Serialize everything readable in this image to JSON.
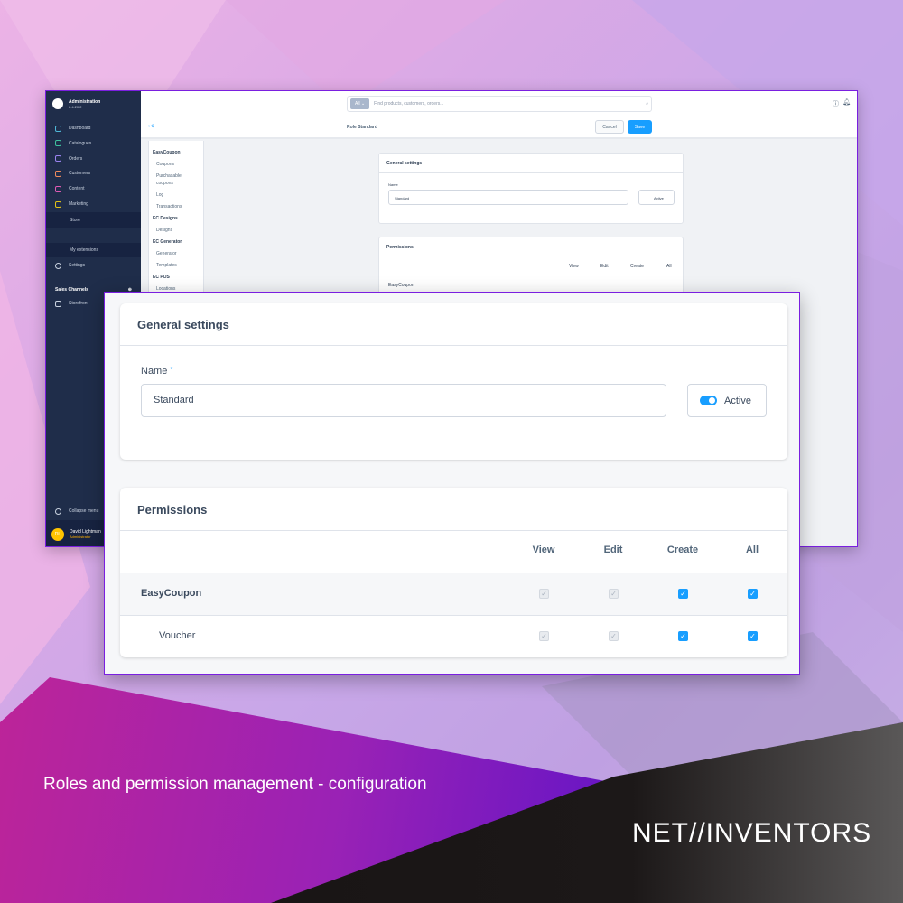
{
  "sidebar": {
    "app_title": "Administration",
    "version": "6.4.20.2",
    "items": [
      {
        "label": "Dashboard",
        "icon": "gauge-icon",
        "color": "#4fb8d8"
      },
      {
        "label": "Catalogues",
        "icon": "catalogue-icon",
        "color": "#3fc29f"
      },
      {
        "label": "Orders",
        "icon": "bag-icon",
        "color": "#9a83f0"
      },
      {
        "label": "Customers",
        "icon": "users-icon",
        "color": "#f08a5d"
      },
      {
        "label": "Content",
        "icon": "content-icon",
        "color": "#e05ab5"
      },
      {
        "label": "Marketing",
        "icon": "megaphone-icon",
        "color": "#e3c317"
      },
      {
        "label": "Extensions",
        "icon": "plug-icon",
        "color": "#189eff"
      }
    ],
    "ext_sub": [
      "Store",
      "My extensions"
    ],
    "settings": "Settings",
    "sales_channels": "Sales Channels",
    "storefront": "Storefront",
    "collapse": "Collapse menu",
    "user": {
      "name": "David Lightman",
      "role": "Administrator",
      "initials": "DL"
    }
  },
  "top": {
    "search_scope": "All",
    "search_placeholder": "Find products, customers, orders..."
  },
  "sub": {
    "title": "Role Standard",
    "cancel": "Cancel",
    "save": "Save"
  },
  "tree": [
    {
      "h": "EasyCoupon"
    },
    {
      "c": "Coupons"
    },
    {
      "c": "Purchasable"
    },
    {
      "c": "coupons"
    },
    {
      "c": "Log"
    },
    {
      "c": "Transactions"
    },
    {
      "h": "EC Designs"
    },
    {
      "c": "Designs"
    },
    {
      "h": "EC Generator"
    },
    {
      "c": "Generator"
    },
    {
      "c": "Templates"
    },
    {
      "h": "EC POS"
    },
    {
      "c": "Locations"
    }
  ],
  "general": {
    "title": "General settings",
    "name_label": "Name",
    "required": "*",
    "name_value": "Standard",
    "active_label": "Active",
    "active": true
  },
  "permissions": {
    "title": "Permissions",
    "columns": [
      "View",
      "Edit",
      "Create",
      "All"
    ],
    "rows": [
      {
        "label": "EasyCoupon",
        "view": true,
        "edit": true,
        "create": true,
        "all": true,
        "view_disabled": true,
        "edit_disabled": true
      },
      {
        "label": "Voucher",
        "view": true,
        "edit": true,
        "create": true,
        "all": true,
        "view_disabled": true,
        "edit_disabled": true
      }
    ]
  },
  "caption": "Roles and permission management - configuration",
  "brand": "NET//INVENTORS",
  "colors": {
    "accent": "#189eff",
    "frame": "#7a1fe0",
    "sidebar": "#1f2d4a"
  }
}
